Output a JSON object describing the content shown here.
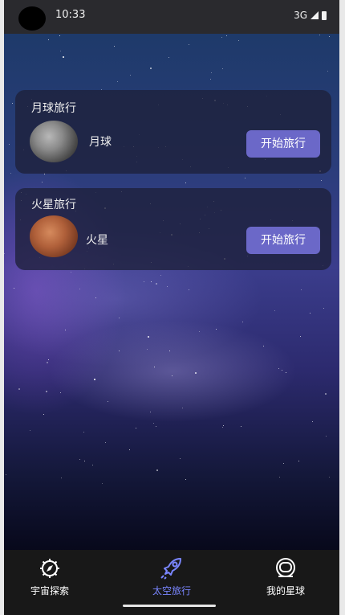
{
  "status_bar": {
    "time": "10:33",
    "network": "3G"
  },
  "cards": [
    {
      "title": "月球旅行",
      "planet_name": "月球",
      "button_label": "开始旅行"
    },
    {
      "title": "火星旅行",
      "planet_name": "火星",
      "button_label": "开始旅行"
    }
  ],
  "bottom_nav": [
    {
      "label": "宇宙探索",
      "icon": "compass-icon",
      "active": false
    },
    {
      "label": "太空旅行",
      "icon": "rocket-icon",
      "active": true
    },
    {
      "label": "我的星球",
      "icon": "astronaut-helmet-icon",
      "active": false
    }
  ],
  "colors": {
    "button": "#6b68c8",
    "active_tab": "#7a86ff",
    "nav_bg": "#181818"
  }
}
